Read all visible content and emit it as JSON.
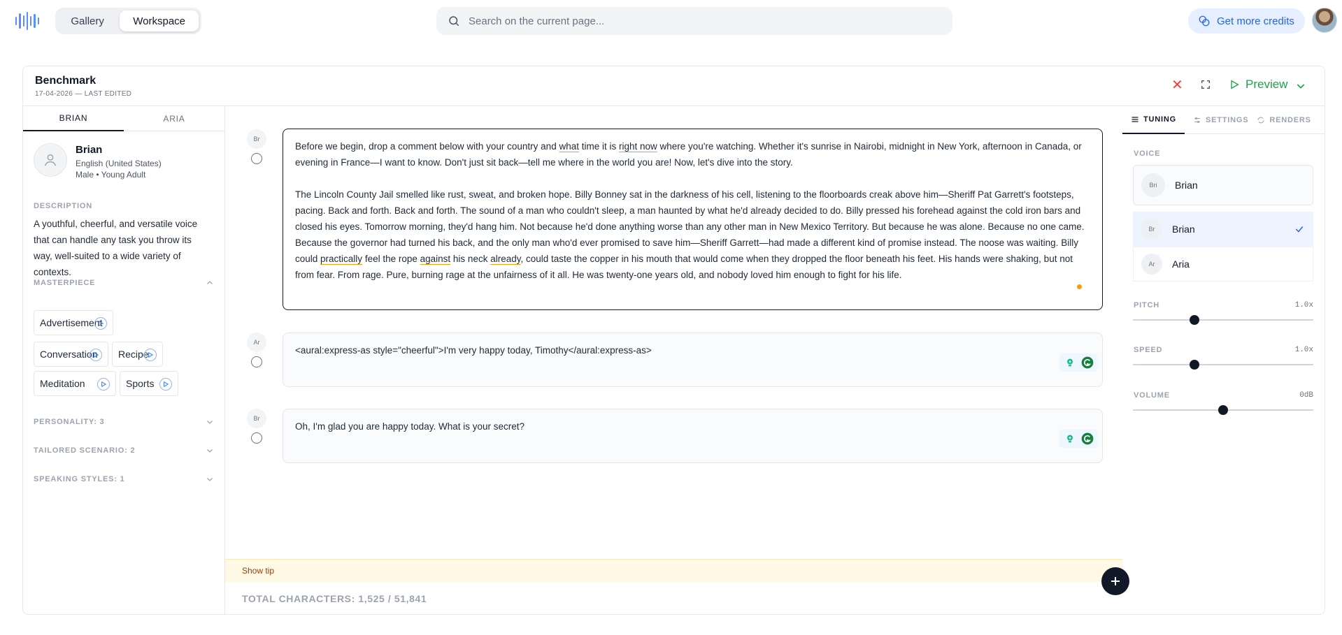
{
  "topbar": {
    "tabs": [
      "Gallery",
      "Workspace"
    ],
    "active_tab": "Workspace",
    "search_placeholder": "Search on the current page...",
    "credits_label": "Get more credits"
  },
  "document": {
    "title": "Benchmark",
    "subtitle": "17-04-2026 — LAST EDITED",
    "preview_label": "Preview"
  },
  "left": {
    "tabs": [
      "BRIAN",
      "ARIA"
    ],
    "voice": {
      "name": "Brian",
      "language": "English (United States)",
      "meta": "Male • Young Adult"
    },
    "description_label": "DESCRIPTION",
    "description": "A youthful, cheerful, and versatile voice that can handle any task you throw its way, well-suited to a wide variety of contexts.",
    "masterpiece_label": "MASTERPIECE",
    "chips": [
      "Advertisement",
      "Conversation",
      "Recipe",
      "Meditation",
      "Sports"
    ],
    "sections": [
      "PERSONALITY: 3",
      "TAILORED SCENARIO: 2",
      "SPEAKING STYLES: 1"
    ]
  },
  "blocks": [
    {
      "speaker": "Br",
      "paragraphs": [
        [
          {
            "t": "Before we begin, drop a comment below with your country and "
          },
          {
            "t": "what",
            "u": true
          },
          {
            "t": " time it is "
          },
          {
            "t": "right now",
            "u": true
          },
          {
            "t": " where you're watching. Whether it's sunrise in Nairobi, midnight in New York, afternoon in Canada, or evening in France—I want to know. Don't just sit back—tell me where in the world you are! Now, let's dive into the story."
          }
        ],
        [
          {
            "t": "The Lincoln County Jail smelled like rust, sweat, and broken hope. Billy Bonney sat in the darkness of his cell, listening to the floorboards creak above him—Sheriff Pat Garrett's footsteps, pacing. Back and forth. Back and forth. The sound of a man who couldn't sleep, a man haunted by what he'd already decided to do. Billy pressed his forehead against the cold iron bars and closed his eyes. Tomorrow morning, they'd hang him. Not because he'd done anything worse than any other man in New Mexico Territory. But because he was alone. Because no one came. Because the governor had turned his back, and the only man who'd ever promised to save him—Sheriff Garrett—had made a different kind of promise instead. The noose was waiting. Billy could "
          },
          {
            "t": "practically",
            "u": true
          },
          {
            "t": " feel the rope "
          },
          {
            "t": "against",
            "u": true
          },
          {
            "t": " his neck "
          },
          {
            "t": "already",
            "u": true
          },
          {
            "t": ", could taste the copper in his mouth that would come when they dropped the floor beneath his feet. His hands were shaking, but not from fear. From rage. Pure, burning rage at the unfairness of it all. He was twenty-one years old, and nobody loved him enough to fight for his life."
          }
        ]
      ]
    },
    {
      "speaker": "Ar",
      "paragraphs": [
        [
          {
            "t": "<aural:express-as style=\"cheerful\">I'm very happy today, Timothy</aural:express-as>"
          }
        ]
      ]
    },
    {
      "speaker": "Br",
      "paragraphs": [
        [
          {
            "t": "Oh, I'm glad you are happy today. What is your secret?"
          }
        ]
      ]
    }
  ],
  "footer": {
    "tip_label": "Show tip",
    "totals": "TOTAL CHARACTERS: 1,525 / 51,841"
  },
  "right": {
    "tabs": [
      "TUNING",
      "SETTINGS",
      "RENDERS"
    ],
    "voice_label": "VOICE",
    "selected_voice": {
      "badge": "Bri",
      "name": "Brian"
    },
    "options": [
      {
        "badge": "Br",
        "name": "Brian",
        "selected": true
      },
      {
        "badge": "Ar",
        "name": "Aria",
        "selected": false
      }
    ],
    "sliders": [
      {
        "label": "PITCH",
        "value_text": "1.0x",
        "fraction": 0.34
      },
      {
        "label": "SPEED",
        "value_text": "1.0x",
        "fraction": 0.34
      },
      {
        "label": "VOLUME",
        "value_text": "0dB",
        "fraction": 0.5
      }
    ]
  },
  "colors": {
    "accent_blue": "#2563eb",
    "preview_green": "#16a34a",
    "close_red": "#ef4444",
    "tip_bg": "#fff9e6"
  }
}
